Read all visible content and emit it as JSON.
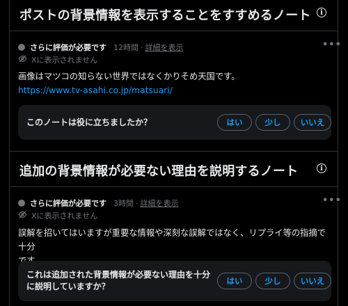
{
  "section1": {
    "title": "ポストの背景情報を表示することをすすめるノート",
    "info_icon": "info-icon",
    "meta": {
      "status": "さらに評価が必要です",
      "time": "12時間",
      "separator": "·",
      "details_link": "詳細を表示"
    },
    "more_icon": "more-horizontal-icon",
    "hidden_label": "Xに表示されません",
    "body_text": "画像はマツコの知らない世界ではなくかりそめ天国です。",
    "url": "https://www.tv-asahi.co.jp/matsuari/",
    "feedback": {
      "question": "このノートは役に立ちましたか？",
      "yes": "はい",
      "somewhat": "少し",
      "no": "いいえ"
    }
  },
  "section2": {
    "title": "追加の背景情報が必要ない理由を説明するノート",
    "info_icon": "info-icon",
    "meta": {
      "status": "さらに評価が必要です",
      "time": "3時間",
      "separator": "·",
      "details_link": "詳細を表示"
    },
    "more_icon": "more-horizontal-icon",
    "hidden_label": "Xに表示されません",
    "body_line1": "誤解を招いてはいますが重要な情報や深刻な誤解ではなく、リプライ等の指摘で十分",
    "body_line2": "です。",
    "feedback": {
      "question_line1": "これは追加された背景情報が必要ない理由を十分",
      "question_line2": "に説明していますか？",
      "yes": "はい",
      "somewhat": "少し",
      "no": "いいえ"
    }
  },
  "colors": {
    "background": "#000000",
    "text": "#e7e9ea",
    "muted": "#71767b",
    "accent": "#1d9bf0",
    "card": "#16181c",
    "border": "#2f3336"
  }
}
